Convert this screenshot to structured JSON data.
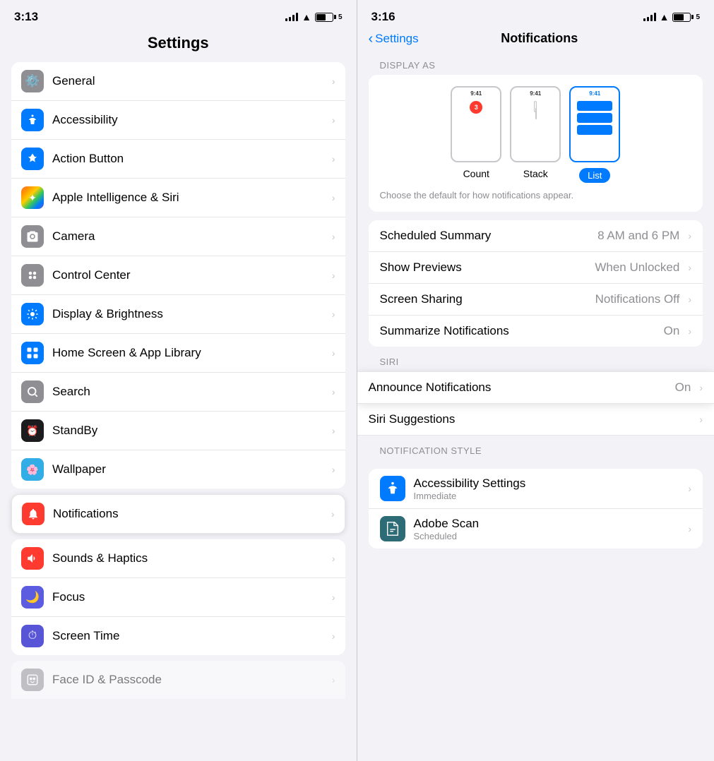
{
  "left": {
    "status": {
      "time": "3:13",
      "battery": "5"
    },
    "title": "Settings",
    "items": [
      {
        "id": "general",
        "label": "General",
        "iconBg": "icon-gray",
        "icon": "⚙️"
      },
      {
        "id": "accessibility",
        "label": "Accessibility",
        "iconBg": "icon-blue",
        "icon": "♿"
      },
      {
        "id": "action-button",
        "label": "Action Button",
        "iconBg": "icon-blue",
        "icon": "✦"
      },
      {
        "id": "apple-intelligence",
        "label": "Apple Intelligence & Siri",
        "iconBg": "icon-orange",
        "icon": "✦"
      },
      {
        "id": "camera",
        "label": "Camera",
        "iconBg": "icon-gray",
        "icon": "📷"
      },
      {
        "id": "control-center",
        "label": "Control Center",
        "iconBg": "icon-gray",
        "icon": "👤"
      },
      {
        "id": "display-brightness",
        "label": "Display & Brightness",
        "iconBg": "icon-blue",
        "icon": "☀️"
      },
      {
        "id": "home-screen",
        "label": "Home Screen & App Library",
        "iconBg": "icon-blue",
        "icon": "📱"
      },
      {
        "id": "search",
        "label": "Search",
        "iconBg": "icon-gray",
        "icon": "🔍"
      },
      {
        "id": "standby",
        "label": "StandBy",
        "iconBg": "icon-dark",
        "icon": "⏰"
      },
      {
        "id": "wallpaper",
        "label": "Wallpaper",
        "iconBg": "icon-teal",
        "icon": "🌸"
      }
    ],
    "highlighted": {
      "id": "notifications",
      "label": "Notifications",
      "iconBg": "icon-red",
      "icon": "🔔"
    },
    "bottomItems": [
      {
        "id": "sounds-haptics",
        "label": "Sounds & Haptics",
        "iconBg": "icon-red",
        "icon": "🔊"
      },
      {
        "id": "focus",
        "label": "Focus",
        "iconBg": "icon-indigo",
        "icon": "🌙"
      },
      {
        "id": "screen-time",
        "label": "Screen Time",
        "iconBg": "icon-purple",
        "icon": "⏱"
      }
    ]
  },
  "right": {
    "status": {
      "time": "3:16",
      "battery": "5"
    },
    "backLabel": "Settings",
    "title": "Notifications",
    "displayAs": {
      "sectionLabel": "DISPLAY AS",
      "options": [
        {
          "id": "count",
          "label": "Count",
          "selected": false
        },
        {
          "id": "stack",
          "label": "Stack",
          "selected": false
        },
        {
          "id": "list",
          "label": "List",
          "selected": true
        }
      ],
      "hint": "Choose the default for how notifications appear."
    },
    "settingsItems": [
      {
        "id": "scheduled-summary",
        "label": "Scheduled Summary",
        "value": "8 AM and 6 PM"
      },
      {
        "id": "show-previews",
        "label": "Show Previews",
        "value": "When Unlocked"
      },
      {
        "id": "screen-sharing",
        "label": "Screen Sharing",
        "value": "Notifications Off"
      },
      {
        "id": "summarize-notifications",
        "label": "Summarize Notifications",
        "value": "On"
      }
    ],
    "siriLabel": "SIRI",
    "announceNotifications": {
      "label": "Announce Notifications",
      "value": "On"
    },
    "siriSuggestions": {
      "label": "Siri Suggestions"
    },
    "notificationStyleLabel": "NOTIFICATION STYLE",
    "apps": [
      {
        "id": "accessibility",
        "name": "Accessibility Settings",
        "subtitle": "Immediate",
        "iconBg": "app-icon-accessibility",
        "icon": "♿"
      },
      {
        "id": "adobe-scan",
        "name": "Adobe Scan",
        "subtitle": "Scheduled",
        "iconBg": "app-icon-adobe",
        "icon": "📄"
      }
    ]
  }
}
